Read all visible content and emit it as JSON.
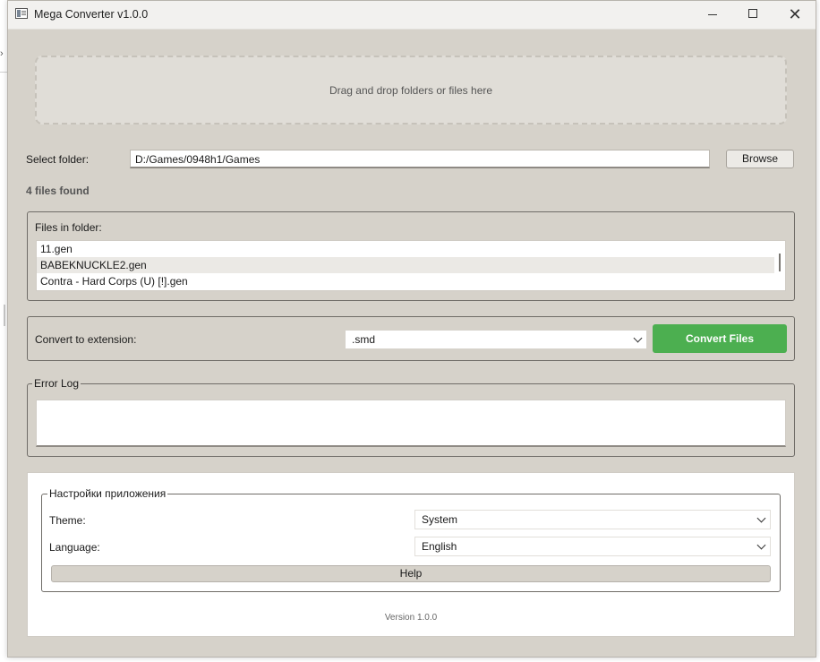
{
  "window": {
    "title": "Mega Converter v1.0.0"
  },
  "dropzone": {
    "text": "Drag and drop folders or files here"
  },
  "folder": {
    "label": "Select folder:",
    "value": "D:/Games/0948h1/Games",
    "browse_label": "Browse"
  },
  "files_found": "4 files found",
  "files_group": {
    "title": "Files in folder:",
    "items": [
      "11.gen",
      "BABEKNUCKLE2.gen",
      "Contra - Hard Corps (U) [!].gen"
    ],
    "selected_index": 1
  },
  "convert": {
    "label": "Convert to extension:",
    "selected": ".smd",
    "button_label": "Convert Files",
    "button_color": "#4caf50"
  },
  "error_log": {
    "title": "Error Log"
  },
  "settings": {
    "title": "Настройки приложения",
    "theme_label": "Theme:",
    "theme_value": "System",
    "language_label": "Language:",
    "language_value": "English",
    "help_label": "Help"
  },
  "version": "Version 1.0.0"
}
